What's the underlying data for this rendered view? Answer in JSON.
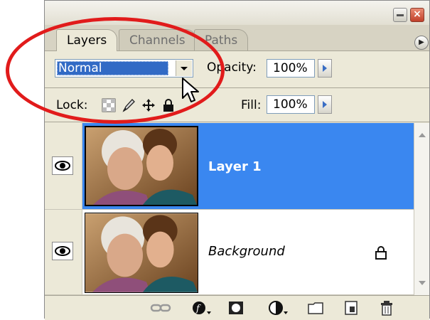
{
  "tabs": [
    {
      "label": "Layers",
      "active": true
    },
    {
      "label": "Channels",
      "active": false
    },
    {
      "label": "Paths",
      "active": false
    }
  ],
  "blend_mode": {
    "value": "Normal"
  },
  "opacity": {
    "label": "Opacity:",
    "value": "100%"
  },
  "lock": {
    "label": "Lock:"
  },
  "fill": {
    "label": "Fill:",
    "value": "100%"
  },
  "layers": [
    {
      "name": "Layer 1",
      "selected": true,
      "visible": true
    },
    {
      "name": "Background",
      "selected": false,
      "visible": true,
      "locked": true
    }
  ],
  "colors": {
    "selection": "#3a87f0",
    "annotation": "#e11b1b",
    "panel": "#ece9d8"
  },
  "icons": [
    "link-icon",
    "layer-style-icon",
    "layer-mask-icon",
    "adjustment-layer-icon",
    "new-group-icon",
    "new-layer-icon",
    "trash-icon"
  ]
}
